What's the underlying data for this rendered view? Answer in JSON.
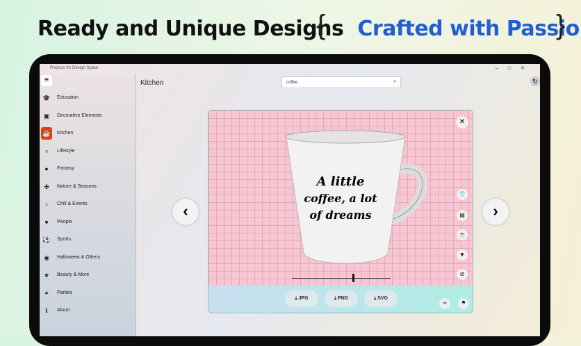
{
  "headline": {
    "part1": "Ready and Unique Designs",
    "part2": "Crafted with Passion"
  },
  "app": {
    "title": "Projects for Design Space",
    "heading": "Kitchen"
  },
  "search": {
    "value": "coffee"
  },
  "sidebar": {
    "items": [
      {
        "label": "Education",
        "icon": "mortarboard-icon",
        "g": "🎓"
      },
      {
        "label": "Decorative Elements",
        "icon": "layers-icon",
        "g": "▣"
      },
      {
        "label": "Kitchen",
        "icon": "cup-icon",
        "g": "☕"
      },
      {
        "label": "Lifestyle",
        "icon": "lamp-icon",
        "g": "♆"
      },
      {
        "label": "Fantasy",
        "icon": "balloon-icon",
        "g": "●"
      },
      {
        "label": "Nature & Seasons",
        "icon": "maple-leaf-icon",
        "g": "✤"
      },
      {
        "label": "Chill & Events",
        "icon": "chair-icon",
        "g": "♪"
      },
      {
        "label": "People",
        "icon": "heart-icon",
        "g": "♥"
      },
      {
        "label": "Sports",
        "icon": "ball-icon",
        "g": "⚽"
      },
      {
        "label": "Halloween & Others",
        "icon": "pumpkin-icon",
        "g": "◉"
      },
      {
        "label": "Beauty & More",
        "icon": "star-icon",
        "g": "★"
      },
      {
        "label": "Parties",
        "icon": "party-popper-icon",
        "g": "✶"
      },
      {
        "label": "About",
        "icon": "info-icon",
        "g": "ℹ"
      }
    ],
    "active": 2
  },
  "preview": {
    "mug_text": [
      "A little",
      "coffee, a lot",
      "of dreams"
    ],
    "size_slider": 0.61
  },
  "downloads": [
    "⤓ JPG",
    "⤓ PNG",
    "⤓ SVG"
  ],
  "colors": {
    "accent": "#d9431b",
    "canvas": "#f6c6d2"
  }
}
